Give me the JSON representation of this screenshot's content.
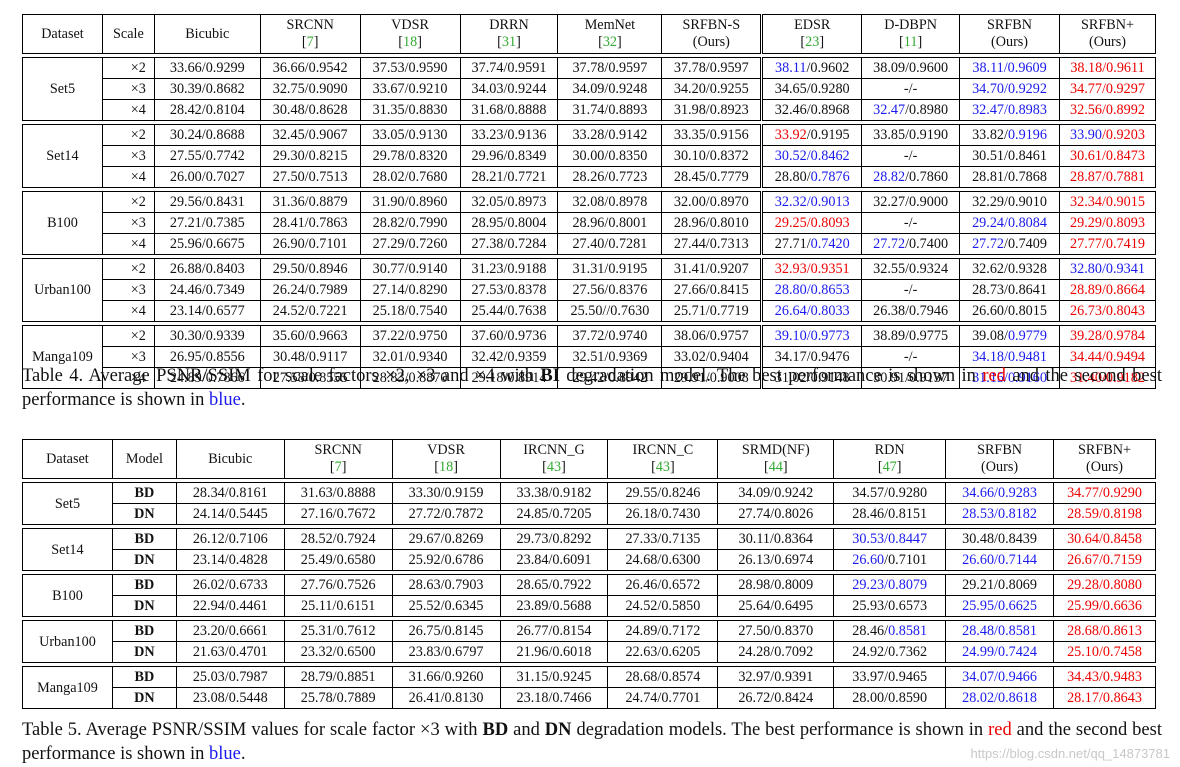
{
  "table4": {
    "header": [
      {
        "l1": "Dataset",
        "l2": "",
        "cite": ""
      },
      {
        "l1": "Scale",
        "l2": "",
        "cite": ""
      },
      {
        "l1": "Bicubic",
        "l2": "",
        "cite": ""
      },
      {
        "l1": "SRCNN",
        "l2": "[",
        "cite": "7"
      },
      {
        "l1": "VDSR",
        "l2": "[",
        "cite": "18"
      },
      {
        "l1": "DRRN",
        "l2": "[",
        "cite": "31"
      },
      {
        "l1": "MemNet",
        "l2": "[",
        "cite": "32"
      },
      {
        "l1": "SRFBN-S",
        "l2": "(Ours)",
        "cite": ""
      },
      {
        "l1": "EDSR",
        "l2": "[",
        "cite": "23"
      },
      {
        "l1": "D-DBPN",
        "l2": "[",
        "cite": "11"
      },
      {
        "l1": "SRFBN",
        "l2": "(Ours)",
        "cite": ""
      },
      {
        "l1": "SRFBN+",
        "l2": "(Ours)",
        "cite": ""
      }
    ],
    "groups": [
      {
        "name": "Set5",
        "rows": [
          [
            "×2",
            "33.66/0.9299",
            "36.66/0.9542",
            "37.53/0.9590",
            "37.74/0.9591",
            "37.78/0.9597",
            "37.78/0.9597",
            [
              [
                "38.11",
                "b"
              ],
              [
                "/0.9602",
                ""
              ]
            ],
            "38.09/0.9600",
            [
              [
                "38.11/0.9609",
                "b"
              ]
            ],
            [
              [
                "38.18/0.9611",
                "r"
              ]
            ]
          ],
          [
            "×3",
            "30.39/0.8682",
            "32.75/0.9090",
            "33.67/0.9210",
            "34.03/0.9244",
            "34.09/0.9248",
            "34.20/0.9255",
            "34.65/0.9280",
            "-/-",
            [
              [
                "34.70/0.9292",
                "b"
              ]
            ],
            [
              [
                "34.77/0.9297",
                "r"
              ]
            ]
          ],
          [
            "×4",
            "28.42/0.8104",
            "30.48/0.8628",
            "31.35/0.8830",
            "31.68/0.8888",
            "31.74/0.8893",
            "31.98/0.8923",
            "32.46/0.8968",
            [
              [
                "32.47",
                "b"
              ],
              [
                "/0.8980",
                ""
              ]
            ],
            [
              [
                "32.47/0.8983",
                "b"
              ]
            ],
            [
              [
                "32.56/0.8992",
                "r"
              ]
            ]
          ]
        ]
      },
      {
        "name": "Set14",
        "rows": [
          [
            "×2",
            "30.24/0.8688",
            "32.45/0.9067",
            "33.05/0.9130",
            "33.23/0.9136",
            "33.28/0.9142",
            "33.35/0.9156",
            [
              [
                "33.92",
                "r"
              ],
              [
                "/0.9195",
                ""
              ]
            ],
            "33.85/0.9190",
            [
              [
                "33.82/",
                ""
              ],
              [
                "0.9196",
                "b"
              ]
            ],
            [
              [
                "33.90",
                "b"
              ],
              [
                "/0.9203",
                "r"
              ]
            ]
          ],
          [
            "×3",
            "27.55/0.7742",
            "29.30/0.8215",
            "29.78/0.8320",
            "29.96/0.8349",
            "30.00/0.8350",
            "30.10/0.8372",
            [
              [
                "30.52/0.8462",
                "b"
              ]
            ],
            "-/-",
            "30.51/0.8461",
            [
              [
                "30.61/0.8473",
                "r"
              ]
            ]
          ],
          [
            "×4",
            "26.00/0.7027",
            "27.50/0.7513",
            "28.02/0.7680",
            "28.21/0.7721",
            "28.26/0.7723",
            "28.45/0.7779",
            [
              [
                "28.80/",
                ""
              ],
              [
                "0.7876",
                "b"
              ]
            ],
            [
              [
                "28.82",
                "b"
              ],
              [
                "/0.7860",
                ""
              ]
            ],
            "28.81/0.7868",
            [
              [
                "28.87/0.7881",
                "r"
              ]
            ]
          ]
        ]
      },
      {
        "name": "B100",
        "rows": [
          [
            "×2",
            "29.56/0.8431",
            "31.36/0.8879",
            "31.90/0.8960",
            "32.05/0.8973",
            "32.08/0.8978",
            "32.00/0.8970",
            [
              [
                "32.32/0.9013",
                "b"
              ]
            ],
            "32.27/0.9000",
            "32.29/0.9010",
            [
              [
                "32.34/0.9015",
                "r"
              ]
            ]
          ],
          [
            "×3",
            "27.21/0.7385",
            "28.41/0.7863",
            "28.82/0.7990",
            "28.95/0.8004",
            "28.96/0.8001",
            "28.96/0.8010",
            [
              [
                "29.25/0.8093",
                "r"
              ]
            ],
            "-/-",
            [
              [
                "29.24/0.8084",
                "b"
              ]
            ],
            [
              [
                "29.29/0.8093",
                "r"
              ]
            ]
          ],
          [
            "×4",
            "25.96/0.6675",
            "26.90/0.7101",
            "27.29/0.7260",
            "27.38/0.7284",
            "27.40/0.7281",
            "27.44/0.7313",
            [
              [
                "27.71/",
                ""
              ],
              [
                "0.7420",
                "b"
              ]
            ],
            [
              [
                "27.72",
                "b"
              ],
              [
                "/0.7400",
                ""
              ]
            ],
            [
              [
                "27.72",
                "b"
              ],
              [
                "/0.7409",
                ""
              ]
            ],
            [
              [
                "27.77/0.7419",
                "r"
              ]
            ]
          ]
        ]
      },
      {
        "name": "Urban100",
        "rows": [
          [
            "×2",
            "26.88/0.8403",
            "29.50/0.8946",
            "30.77/0.9140",
            "31.23/0.9188",
            "31.31/0.9195",
            "31.41/0.9207",
            [
              [
                "32.93/0.9351",
                "r"
              ]
            ],
            "32.55/0.9324",
            "32.62/0.9328",
            [
              [
                "32.80/0.9341",
                "b"
              ]
            ]
          ],
          [
            "×3",
            "24.46/0.7349",
            "26.24/0.7989",
            "27.14/0.8290",
            "27.53/0.8378",
            "27.56/0.8376",
            "27.66/0.8415",
            [
              [
                "28.80/0.8653",
                "b"
              ]
            ],
            "-/-",
            "28.73/0.8641",
            [
              [
                "28.89/0.8664",
                "r"
              ]
            ]
          ],
          [
            "×4",
            "23.14/0.6577",
            "24.52/0.7221",
            "25.18/0.7540",
            "25.44/0.7638",
            "25.50//0.7630",
            "25.71/0.7719",
            [
              [
                "26.64/0.8033",
                "b"
              ]
            ],
            "26.38/0.7946",
            "26.60/0.8015",
            [
              [
                "26.73/0.8043",
                "r"
              ]
            ]
          ]
        ]
      },
      {
        "name": "Manga109",
        "rows": [
          [
            "×2",
            "30.30/0.9339",
            "35.60/0.9663",
            "37.22/0.9750",
            "37.60/0.9736",
            "37.72/0.9740",
            "38.06/0.9757",
            [
              [
                "39.10/0.9773",
                "b"
              ]
            ],
            "38.89/0.9775",
            [
              [
                "39.08/",
                ""
              ],
              [
                "0.9779",
                "b"
              ]
            ],
            [
              [
                "39.28/0.9784",
                "r"
              ]
            ]
          ],
          [
            "×3",
            "26.95/0.8556",
            "30.48/0.9117",
            "32.01/0.9340",
            "32.42/0.9359",
            "32.51/0.9369",
            "33.02/0.9404",
            "34.17/0.9476",
            "-/-",
            [
              [
                "34.18/0.9481",
                "b"
              ]
            ],
            [
              [
                "34.44/0.9494",
                "r"
              ]
            ]
          ],
          [
            "×4",
            "24.89/0.7866",
            "27.58/0.8555",
            "28.83/0.8870",
            "29.18/0.8914",
            "29.42/0.8942",
            "29.91/0.9008",
            "31.02/0.9148",
            "30.91/0.9137",
            [
              [
                "31.15/0.9160",
                "b"
              ]
            ],
            [
              [
                "31.40/0.9182",
                "r"
              ]
            ]
          ]
        ]
      }
    ]
  },
  "caption4": {
    "prefix": "Table 4. Average PSNR/SSIM for scale factors ×2, ×3 and ×4 with ",
    "bold": "BI",
    "mid": " degradation model. The best performance is shown in ",
    "red": "red",
    "mid2": " and the second best performance is shown in ",
    "blue": "blue",
    "end": "."
  },
  "table5": {
    "header": [
      {
        "l1": "Dataset",
        "l2": "",
        "cite": ""
      },
      {
        "l1": "Model",
        "l2": "",
        "cite": ""
      },
      {
        "l1": "Bicubic",
        "l2": "",
        "cite": ""
      },
      {
        "l1": "SRCNN",
        "l2": "[",
        "cite": "7"
      },
      {
        "l1": "VDSR",
        "l2": "[",
        "cite": "18"
      },
      {
        "l1": "IRCNN_G",
        "l2": "[",
        "cite": "43"
      },
      {
        "l1": "IRCNN_C",
        "l2": "[",
        "cite": "43"
      },
      {
        "l1": "SRMD(NF)",
        "l2": "[",
        "cite": "44"
      },
      {
        "l1": "RDN",
        "l2": "[",
        "cite": "47"
      },
      {
        "l1": "SRFBN",
        "l2": "(Ours)",
        "cite": ""
      },
      {
        "l1": "SRFBN+",
        "l2": "(Ours)",
        "cite": ""
      }
    ],
    "groups": [
      {
        "name": "Set5",
        "rows": [
          [
            "BD",
            "28.34/0.8161",
            "31.63/0.8888",
            "33.30/0.9159",
            "33.38/0.9182",
            "29.55/0.8246",
            "34.09/0.9242",
            "34.57/0.9280",
            [
              [
                "34.66/0.9283",
                "b"
              ]
            ],
            [
              [
                "34.77/0.9290",
                "r"
              ]
            ]
          ],
          [
            "DN",
            "24.14/0.5445",
            "27.16/0.7672",
            "27.72/0.7872",
            "24.85/0.7205",
            "26.18/0.7430",
            "27.74/0.8026",
            "28.46/0.8151",
            [
              [
                "28.53/0.8182",
                "b"
              ]
            ],
            [
              [
                "28.59/0.8198",
                "r"
              ]
            ]
          ]
        ]
      },
      {
        "name": "Set14",
        "rows": [
          [
            "BD",
            "26.12/0.7106",
            "28.52/0.7924",
            "29.67/0.8269",
            "29.73/0.8292",
            "27.33/0.7135",
            "30.11/0.8364",
            [
              [
                "30.53/0.8447",
                "b"
              ]
            ],
            "30.48/0.8439",
            [
              [
                "30.64/0.8458",
                "r"
              ]
            ]
          ],
          [
            "DN",
            "23.14/0.4828",
            "25.49/0.6580",
            "25.92/0.6786",
            "23.84/0.6091",
            "24.68/0.6300",
            "26.13/0.6974",
            [
              [
                "26.60",
                "b"
              ],
              [
                "/0.7101",
                ""
              ]
            ],
            [
              [
                "26.60/0.7144",
                "b"
              ]
            ],
            [
              [
                "26.67/0.7159",
                "r"
              ]
            ]
          ]
        ]
      },
      {
        "name": "B100",
        "rows": [
          [
            "BD",
            "26.02/0.6733",
            "27.76/0.7526",
            "28.63/0.7903",
            "28.65/0.7922",
            "26.46/0.6572",
            "28.98/0.8009",
            [
              [
                "29.23/0.8079",
                "b"
              ]
            ],
            "29.21/0.8069",
            [
              [
                "29.28/0.8080",
                "r"
              ]
            ]
          ],
          [
            "DN",
            "22.94/0.4461",
            "25.11/0.6151",
            "25.52/0.6345",
            "23.89/0.5688",
            "24.52/0.5850",
            "25.64/0.6495",
            "25.93/0.6573",
            [
              [
                "25.95/0.6625",
                "b"
              ]
            ],
            [
              [
                "25.99/0.6636",
                "r"
              ]
            ]
          ]
        ]
      },
      {
        "name": "Urban100",
        "rows": [
          [
            "BD",
            "23.20/0.6661",
            "25.31/0.7612",
            "26.75/0.8145",
            "26.77/0.8154",
            "24.89/0.7172",
            "27.50/0.8370",
            [
              [
                "28.46/",
                ""
              ],
              [
                "0.8581",
                "b"
              ]
            ],
            [
              [
                "28.48/0.8581",
                "b"
              ]
            ],
            [
              [
                "28.68/0.8613",
                "r"
              ]
            ]
          ],
          [
            "DN",
            "21.63/0.4701",
            "23.32/0.6500",
            "23.83/0.6797",
            "21.96/0.6018",
            "22.63/0.6205",
            "24.28/0.7092",
            "24.92/0.7362",
            [
              [
                "24.99/0.7424",
                "b"
              ]
            ],
            [
              [
                "25.10/0.7458",
                "r"
              ]
            ]
          ]
        ]
      },
      {
        "name": "Manga109",
        "rows": [
          [
            "BD",
            "25.03/0.7987",
            "28.79/0.8851",
            "31.66/0.9260",
            "31.15/0.9245",
            "28.68/0.8574",
            "32.97/0.9391",
            "33.97/0.9465",
            [
              [
                "34.07/0.9466",
                "b"
              ]
            ],
            [
              [
                "34.43/0.9483",
                "r"
              ]
            ]
          ],
          [
            "DN",
            "23.08/0.5448",
            "25.78/0.7889",
            "26.41/0.8130",
            "23.18/0.7466",
            "24.74/0.7701",
            "26.72/0.8424",
            "28.00/0.8590",
            [
              [
                "28.02/0.8618",
                "b"
              ]
            ],
            [
              [
                "28.17/0.8643",
                "r"
              ]
            ]
          ]
        ]
      }
    ]
  },
  "caption5": {
    "prefix": "Table 5. Average PSNR/SSIM values for scale factor ×3 with ",
    "bold": "BD",
    "mid0": " and ",
    "bold2": "DN",
    "mid": " degradation models. The best performance is shown in ",
    "red": "red",
    "mid2": " and the second best performance is shown in ",
    "blue": "blue",
    "end": "."
  },
  "watermark": "https://blog.csdn.net/qq_14873781"
}
